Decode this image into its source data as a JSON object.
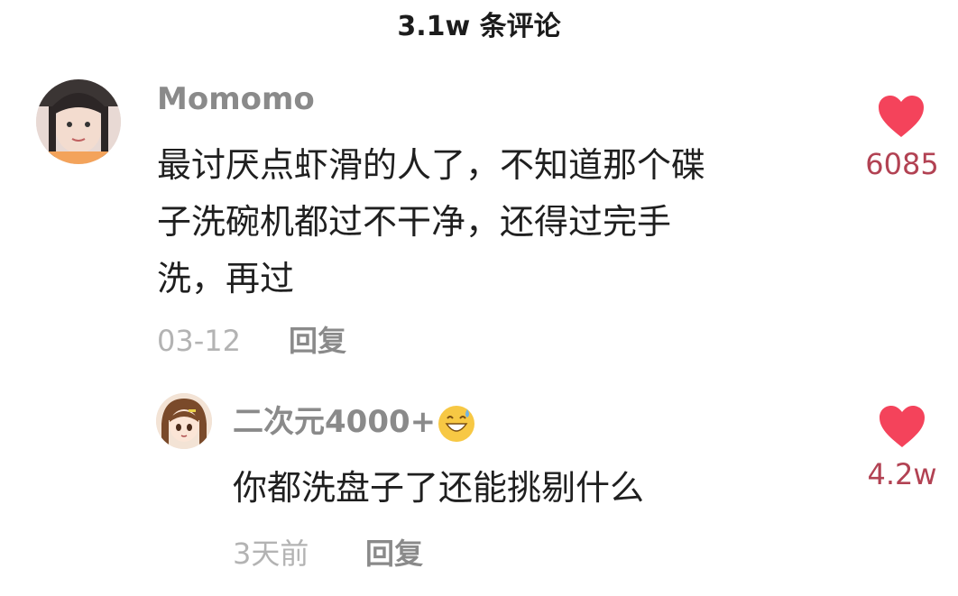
{
  "header": {
    "title": "3.1w 条评论"
  },
  "colors": {
    "like": "#f4435b",
    "like_count": "#b24253",
    "muted": "#8a8a8a",
    "date": "#b3b3b3"
  },
  "comments": [
    {
      "username": "Momomo",
      "avatar_icon": "user-avatar-photo",
      "text_lines": [
        "最讨厌点虾滑的人了，不知道那个碟",
        "子洗碗机都过不干净，还得过完手",
        "洗，再过"
      ],
      "date": "03-12",
      "reply_label": "回复",
      "like_icon": "heart-icon",
      "likes": "6085"
    },
    {
      "username": "二次元4000+",
      "username_emoji": "grinning-sweat-emoji",
      "avatar_icon": "anime-avatar",
      "text": "你都洗盘子了还能挑剔什么",
      "date": "3天前",
      "reply_label": "回复",
      "like_icon": "heart-icon",
      "likes": "4.2w"
    }
  ]
}
